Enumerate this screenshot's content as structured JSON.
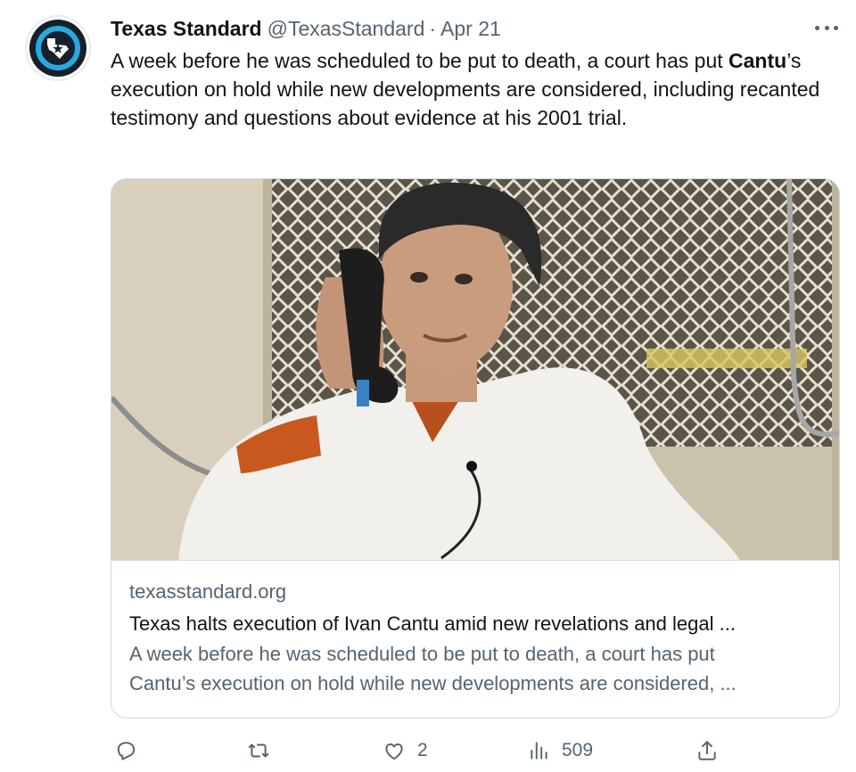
{
  "account": {
    "name": "Texas Standard",
    "handle": "@TexasStandard",
    "separator": "·",
    "date": "Apr 21"
  },
  "tweet": {
    "text_part1": "A week before he was scheduled to be put to death, a court has put ",
    "text_bold": "Cantu",
    "text_part2": "’s execution on hold while new developments are considered, including recanted testimony and questions about evidence at his 2001 trial."
  },
  "card": {
    "domain": "texasstandard.org",
    "title": "Texas halts execution of Ivan Cantu amid new revelations and legal ...",
    "description_line1": "A week before he was scheduled to be put to death, a court has put",
    "description_line2": "Cantu’s execution on hold while new developments are considered, ..."
  },
  "actions": {
    "reply_count": "",
    "retweet_count": "",
    "like_count": "2",
    "views_count": "509"
  },
  "icons": {
    "avatar": "texas-star-logo-icon",
    "more": "more-options-icon",
    "reply": "reply-icon",
    "retweet": "retweet-icon",
    "like": "heart-icon",
    "views": "views-chart-icon",
    "share": "share-icon"
  },
  "colors": {
    "brand_blue": "#29a9e0",
    "text_primary": "#0f1419",
    "text_secondary": "#536471",
    "border": "#cfd9de"
  }
}
